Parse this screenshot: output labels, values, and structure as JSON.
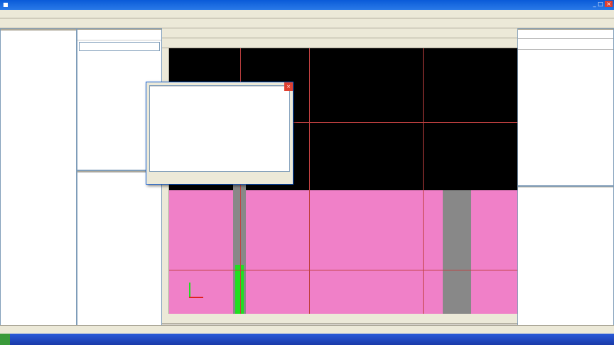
{
  "title": "",
  "menu": [],
  "toolbar1": [],
  "toolbar2": [],
  "toolbar3": [],
  "left_panel": {
    "title": "",
    "tab": "",
    "tree": []
  },
  "comp_list": {
    "title": "",
    "search_placeholder": "",
    "header": "",
    "rows": []
  },
  "prop_panel": {
    "title": "",
    "col_name": "",
    "col_value": "",
    "col_extra": "",
    "rows": []
  },
  "dialog": {
    "title": "",
    "cols": [
      "",
      "",
      ""
    ],
    "rows": []
  },
  "right_panel": {
    "title": "",
    "tabs": [],
    "buttons": [],
    "col_name": "",
    "col_scale": "",
    "rows": []
  },
  "cad_layers": {
    "title": "",
    "items": []
  },
  "vertical_toolbar": [],
  "canvas": {
    "axes_top": [],
    "axes_right": []
  },
  "coord_bar": [],
  "status": "",
  "taskbar": {
    "items": [],
    "clock": ""
  },
  "colors": {
    "canvas_bg": "#000000",
    "pink": "#f080c8",
    "highlight": "#ffff00",
    "selected": "#5a8a2a"
  }
}
